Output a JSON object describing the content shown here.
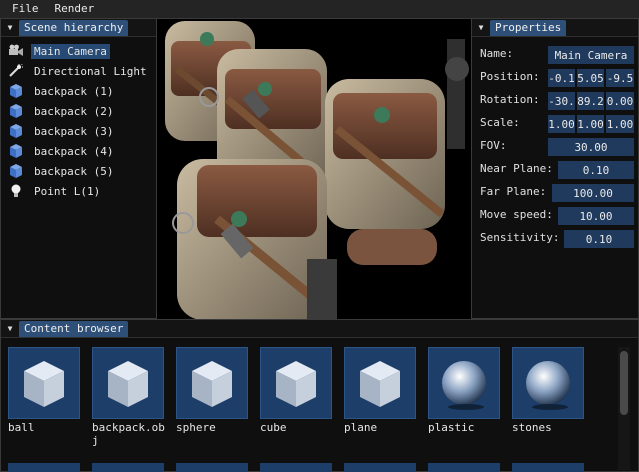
{
  "menu": {
    "file": "File",
    "render": "Render"
  },
  "hierarchy": {
    "title": "Scene hierarchy",
    "items": [
      {
        "label": "Main Camera",
        "icon": "camera-icon",
        "selected": true
      },
      {
        "label": "Directional Light",
        "icon": "directional-light-icon",
        "selected": false
      },
      {
        "label": "backpack (1)",
        "icon": "cube-icon",
        "selected": false
      },
      {
        "label": "backpack (2)",
        "icon": "cube-icon",
        "selected": false
      },
      {
        "label": "backpack (3)",
        "icon": "cube-icon",
        "selected": false
      },
      {
        "label": "backpack (4)",
        "icon": "cube-icon",
        "selected": false
      },
      {
        "label": "backpack (5)",
        "icon": "cube-icon",
        "selected": false
      },
      {
        "label": "Point L(1)",
        "icon": "point-light-icon",
        "selected": false
      }
    ]
  },
  "properties": {
    "title": "Properties",
    "name_label": "Name:",
    "name_value": "Main Camera",
    "position_label": "Position:",
    "position": [
      "-0.1",
      "5.05",
      "-9.5"
    ],
    "rotation_label": "Rotation:",
    "rotation": [
      "-30.",
      "89.2",
      "0.00"
    ],
    "scale_label": "Scale:",
    "scale": [
      "1.00",
      "1.00",
      "1.00"
    ],
    "fov_label": "FOV:",
    "fov": "30.00",
    "near_label": "Near Plane:",
    "near": "0.10",
    "far_label": "Far Plane:",
    "far": "100.00",
    "speed_label": "Move speed:",
    "speed": "10.00",
    "sens_label": "Sensitivity:",
    "sens": "0.10"
  },
  "content": {
    "title": "Content browser",
    "assets": [
      {
        "label": "ball",
        "kind": "cube"
      },
      {
        "label": "backpack.obj",
        "kind": "cube"
      },
      {
        "label": "sphere",
        "kind": "cube"
      },
      {
        "label": "cube",
        "kind": "cube"
      },
      {
        "label": "plane",
        "kind": "cube"
      },
      {
        "label": "plastic",
        "kind": "sphere"
      },
      {
        "label": "stones",
        "kind": "sphere"
      }
    ]
  }
}
